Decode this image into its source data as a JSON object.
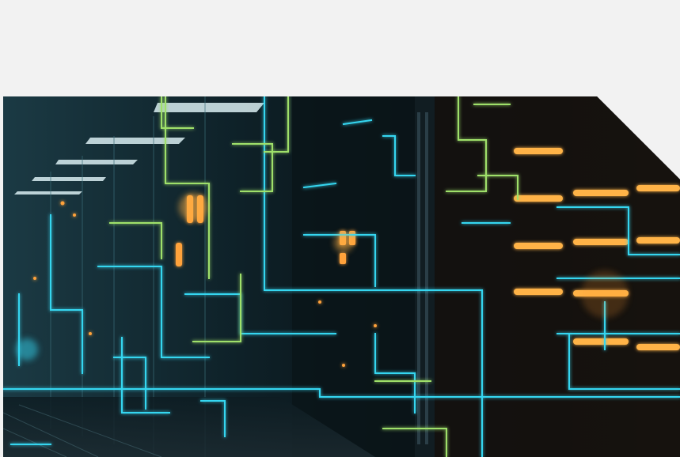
{
  "hero_image": {
    "subject": "data-center-corridor-with-glowing-circuit-lines",
    "colors": {
      "background": "#f2f2f2",
      "dark": "#0a1418",
      "cyan": "#34d6f0",
      "green": "#9fe06a",
      "amber": "#ffb347"
    }
  }
}
